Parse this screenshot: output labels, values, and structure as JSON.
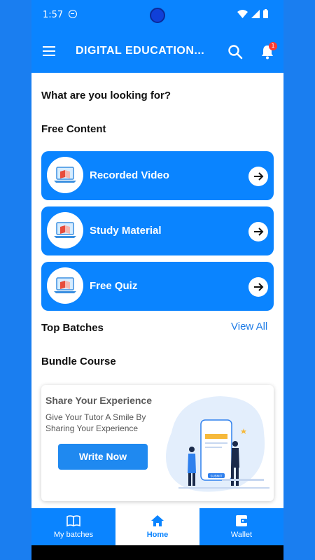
{
  "status_bar": {
    "time": "1:57"
  },
  "app_bar": {
    "title": "DIGITAL EDUCATION...",
    "notification_count": "1"
  },
  "main": {
    "question": "What are you looking for?",
    "free_content_heading": "Free Content",
    "cards": [
      {
        "label": "Recorded Video"
      },
      {
        "label": "Study Material"
      },
      {
        "label": "Free Quiz"
      }
    ],
    "top_batches_heading": "Top Batches",
    "view_all": "View All",
    "bundle_course_heading": "Bundle Course",
    "banner": {
      "title": "Share Your Experience",
      "subtitle": "Give Your Tutor A Smile By Sharing Your Experience",
      "button": "Write Now",
      "illustration_button": "SUBMIT"
    }
  },
  "bottom_nav": {
    "items": [
      {
        "label": "My batches",
        "icon": "book-icon"
      },
      {
        "label": "Home",
        "icon": "home-icon"
      },
      {
        "label": "Wallet",
        "icon": "wallet-icon"
      }
    ],
    "active": "Home"
  },
  "colors": {
    "primary": "#0a84ff",
    "accent": "#1f7ce6",
    "badge": "#ff3b30",
    "background": "#ffffff"
  }
}
